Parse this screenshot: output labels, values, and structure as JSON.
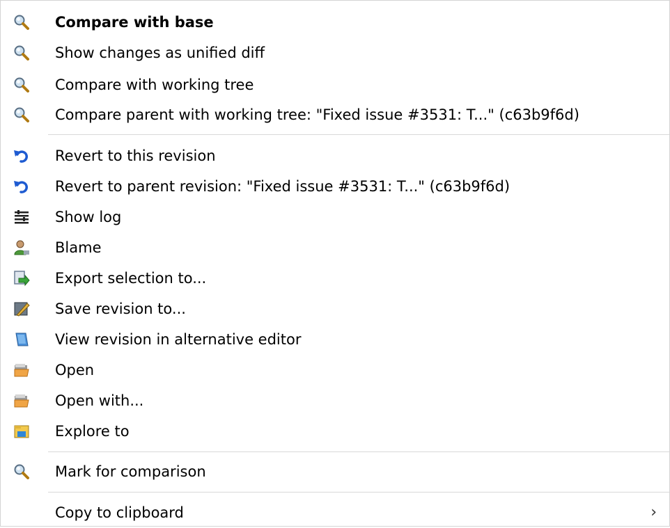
{
  "menu": {
    "items": [
      {
        "label": "Compare with base",
        "icon": "magnifier-icon",
        "bold": true
      },
      {
        "label": "Show changes as unified diff",
        "icon": "magnifier-icon"
      },
      {
        "label": "Compare with working tree",
        "icon": "magnifier-icon"
      },
      {
        "label": "Compare parent with working tree: \"Fixed issue #3531: T...\" (c63b9f6d)",
        "icon": "magnifier-icon"
      },
      {
        "label": "Revert to this revision",
        "icon": "revert-arrow-icon"
      },
      {
        "label": "Revert to parent revision: \"Fixed issue #3531: T...\" (c63b9f6d)",
        "icon": "revert-arrow-icon"
      },
      {
        "label": "Show log",
        "icon": "log-lines-icon"
      },
      {
        "label": "Blame",
        "icon": "blame-person-icon"
      },
      {
        "label": "Export selection to...",
        "icon": "export-icon"
      },
      {
        "label": "Save revision to...",
        "icon": "save-revision-icon"
      },
      {
        "label": "View revision in alternative editor",
        "icon": "alternative-editor-icon"
      },
      {
        "label": "Open",
        "icon": "open-folder-icon"
      },
      {
        "label": "Open with...",
        "icon": "open-with-folder-icon"
      },
      {
        "label": "Explore to",
        "icon": "explore-folder-icon"
      },
      {
        "label": "Mark for comparison",
        "icon": "magnifier-icon"
      },
      {
        "label": "Copy to clipboard",
        "icon": "none",
        "submenu_arrow": "›"
      }
    ]
  },
  "colors": {
    "separator": "#d9d9d9",
    "revert_blue": "#1e5bd1",
    "magnifier_lens": "#7da7c9"
  }
}
